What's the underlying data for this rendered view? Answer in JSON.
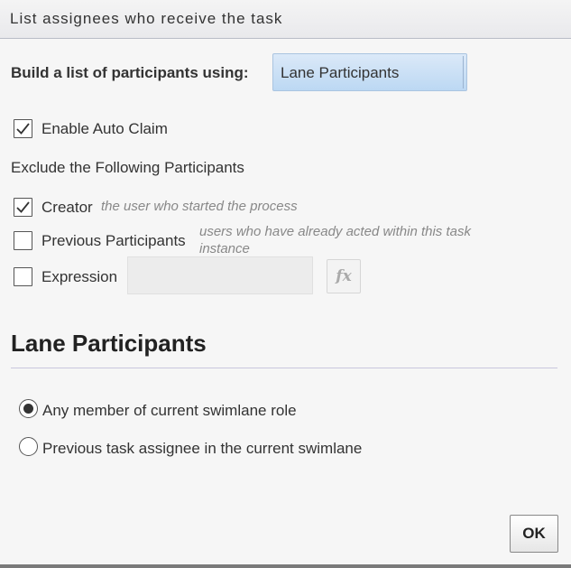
{
  "dialog": {
    "title": "List assignees who receive the task"
  },
  "build_list": {
    "label": "Build a list of participants using:",
    "selected_value": "Lane Participants"
  },
  "auto_claim": {
    "label": "Enable Auto Claim",
    "checked": true
  },
  "exclude": {
    "heading": "Exclude the Following Participants",
    "creator": {
      "label": "Creator",
      "hint": "the user who started the process",
      "checked": true
    },
    "previous": {
      "label": "Previous Participants",
      "hint_line1": "users who have already acted within this task",
      "hint_line2": "instance",
      "checked": false
    },
    "expression": {
      "label": "Expression",
      "value": "",
      "fx_label": "fx",
      "checked": false
    }
  },
  "lane": {
    "heading": "Lane Participants",
    "options": [
      {
        "label": "Any member of current swimlane role",
        "selected": true
      },
      {
        "label": "Previous task assignee in the current swimlane",
        "selected": false
      }
    ]
  },
  "footer": {
    "ok_label": "OK"
  }
}
